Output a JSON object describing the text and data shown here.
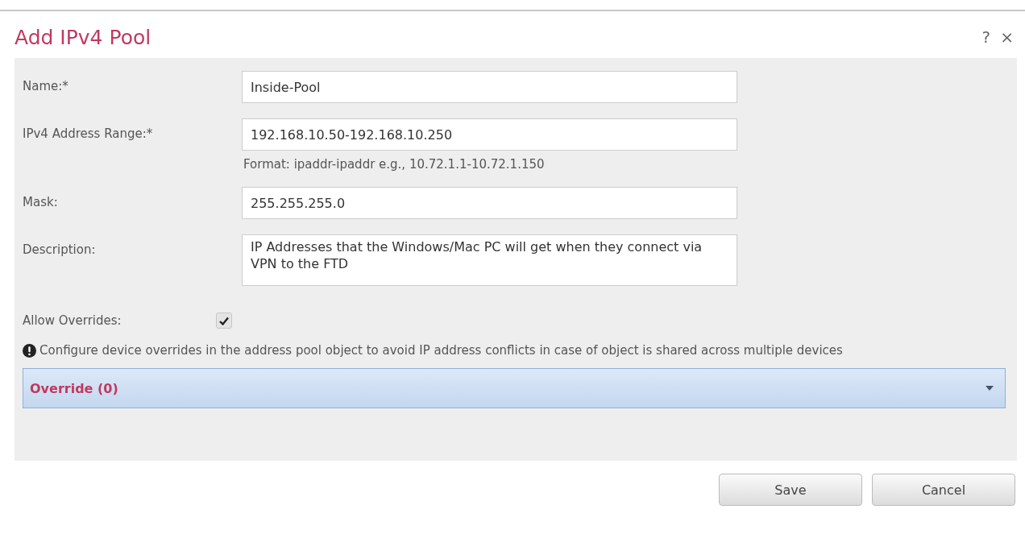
{
  "dialog": {
    "title": "Add IPv4 Pool",
    "help": "?",
    "close": "×"
  },
  "fields": [
    {
      "label": "Name:*",
      "kind": "text",
      "value": "Inside-Pool"
    },
    {
      "label": "IPv4 Address Range:*",
      "kind": "text",
      "value": "192.168.10.50-192.168.10.250",
      "hint": "Format: ipaddr-ipaddr e.g., 10.72.1.1-10.72.1.150"
    },
    {
      "label": "Mask:",
      "kind": "text",
      "value": "255.255.255.0"
    },
    {
      "label": "Description:",
      "kind": "textarea",
      "value": "IP Addresses that the Windows/Mac PC will get when they connect via VPN to the FTD"
    }
  ],
  "allow_overrides": {
    "label": "Allow Overrides:",
    "checked": true
  },
  "note": "Configure device overrides in the address pool object to avoid IP address conflicts in case of object is shared across multiple devices",
  "override": {
    "label": "Override (0)",
    "expanded": false
  },
  "buttons": [
    "Save",
    "Cancel"
  ]
}
